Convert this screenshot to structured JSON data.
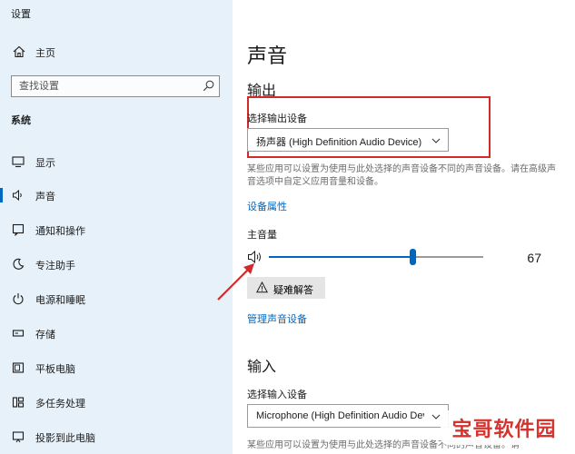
{
  "window": {
    "title": "设置"
  },
  "sidebar": {
    "home_label": "主页",
    "search_placeholder": "查找设置",
    "section_label": "系统",
    "items": [
      {
        "label": "显示",
        "icon": "monitor-icon"
      },
      {
        "label": "声音",
        "icon": "speaker-icon",
        "active": true
      },
      {
        "label": "通知和操作",
        "icon": "notification-icon"
      },
      {
        "label": "专注助手",
        "icon": "moon-icon"
      },
      {
        "label": "电源和睡眠",
        "icon": "power-icon"
      },
      {
        "label": "存储",
        "icon": "storage-icon"
      },
      {
        "label": "平板电脑",
        "icon": "tablet-icon"
      },
      {
        "label": "多任务处理",
        "icon": "multitask-icon"
      },
      {
        "label": "投影到此电脑",
        "icon": "project-icon"
      }
    ]
  },
  "main": {
    "title": "声音",
    "output": {
      "heading": "输出",
      "device_label": "选择输出设备",
      "device_value": "扬声器 (High Definition Audio Device)",
      "description": "某些应用可以设置为使用与此处选择的声音设备不同的声音设备。请在高级声音选项中自定义应用音量和设备。",
      "device_properties_link": "设备属性",
      "volume_label": "主音量",
      "volume_value": 67,
      "troubleshoot_label": "疑难解答",
      "manage_devices_link": "管理声音设备"
    },
    "input": {
      "heading": "输入",
      "device_label": "选择输入设备",
      "device_value": "Microphone (High Definition Audio Device)",
      "description": "某些应用可以设置为使用与此处选择的声音设备不同的声音设备。请"
    }
  },
  "watermark": "宝哥软件园",
  "colors": {
    "accent": "#0067c0",
    "sidebar_bg": "#e6f1f9",
    "highlight": "#d12a2a"
  }
}
